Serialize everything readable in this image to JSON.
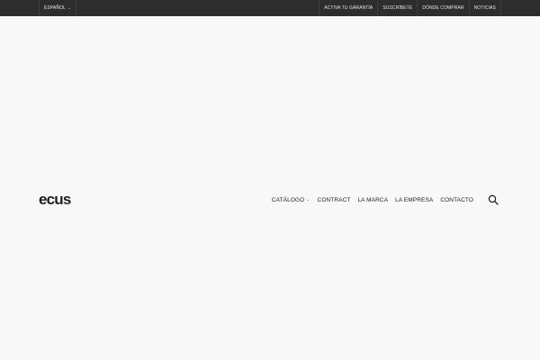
{
  "topbar": {
    "language": "ESPAÑOL",
    "links": [
      "ACTIVA TU GARANTÍA",
      "SUSCRÍBETE",
      "DÓNDE COMPRAR",
      "NOTICIAS"
    ]
  },
  "header": {
    "logo": "ecus",
    "nav": {
      "catalog": "CATÁLOGO",
      "contract": "CONTRACT",
      "brand": "LA MARCA",
      "company": "LA EMPRESA",
      "contact": "CONTACTO"
    }
  },
  "colors": {
    "topbar_bg": "#2d2d2d",
    "page_bg": "#f8f8f8",
    "text": "#1f1f1f"
  },
  "icons": {
    "search": "search-icon",
    "dropdown": "chevron-down-icon"
  }
}
